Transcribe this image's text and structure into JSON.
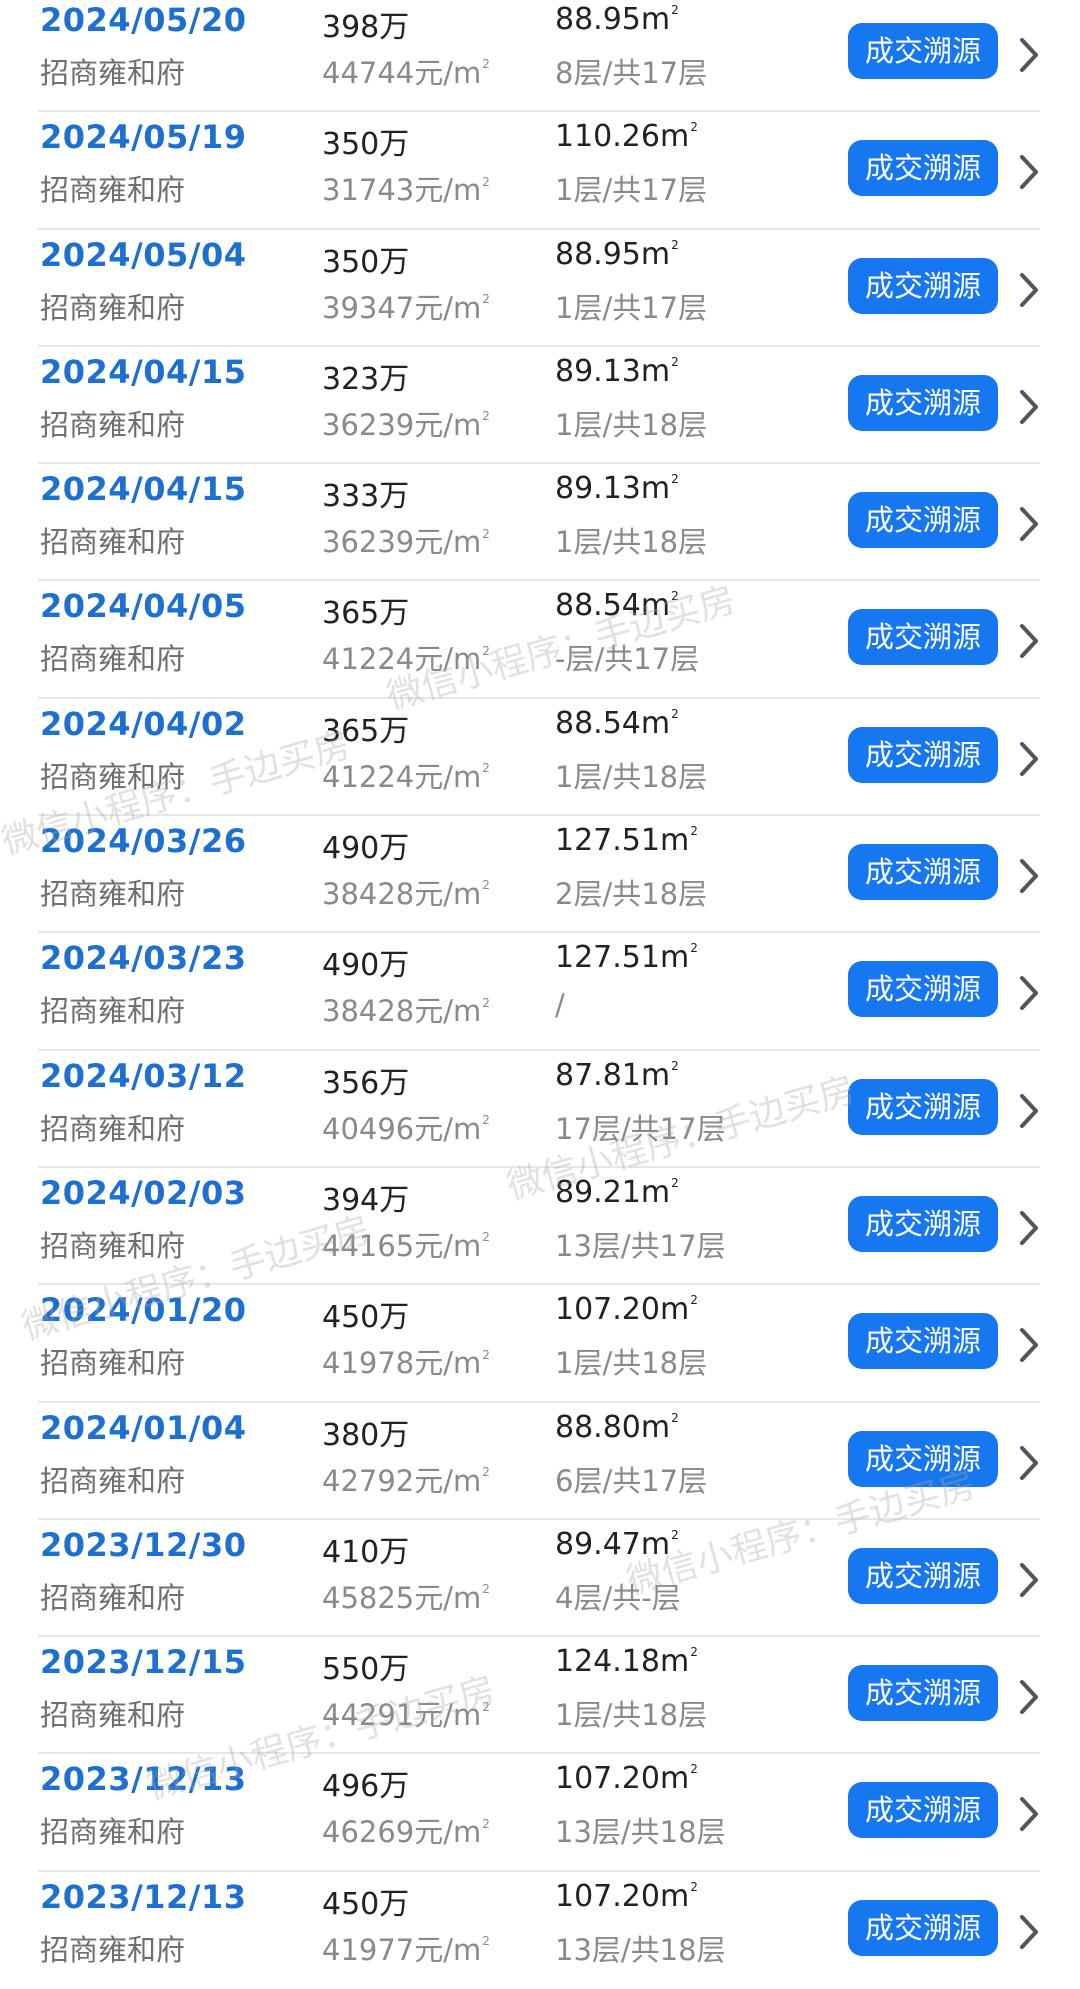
{
  "common": {
    "button_label": "成交溯源",
    "sq_sup": "2"
  },
  "records": [
    {
      "date": "2024/05/20",
      "name": "招商雍和府",
      "price": "398万",
      "unit_price": "44744元/m",
      "area": "88.95m",
      "floor": "8层/共17层"
    },
    {
      "date": "2024/05/19",
      "name": "招商雍和府",
      "price": "350万",
      "unit_price": "31743元/m",
      "area": "110.26m",
      "floor": "1层/共17层"
    },
    {
      "date": "2024/05/04",
      "name": "招商雍和府",
      "price": "350万",
      "unit_price": "39347元/m",
      "area": "88.95m",
      "floor": "1层/共17层"
    },
    {
      "date": "2024/04/15",
      "name": "招商雍和府",
      "price": "323万",
      "unit_price": "36239元/m",
      "area": "89.13m",
      "floor": "1层/共18层"
    },
    {
      "date": "2024/04/15",
      "name": "招商雍和府",
      "price": "333万",
      "unit_price": "36239元/m",
      "area": "89.13m",
      "floor": "1层/共18层"
    },
    {
      "date": "2024/04/05",
      "name": "招商雍和府",
      "price": "365万",
      "unit_price": "41224元/m",
      "area": "88.54m",
      "floor": "-层/共17层"
    },
    {
      "date": "2024/04/02",
      "name": "招商雍和府",
      "price": "365万",
      "unit_price": "41224元/m",
      "area": "88.54m",
      "floor": "1层/共18层"
    },
    {
      "date": "2024/03/26",
      "name": "招商雍和府",
      "price": "490万",
      "unit_price": "38428元/m",
      "area": "127.51m",
      "floor": "2层/共18层"
    },
    {
      "date": "2024/03/23",
      "name": "招商雍和府",
      "price": "490万",
      "unit_price": "38428元/m",
      "area": "127.51m",
      "floor": "/"
    },
    {
      "date": "2024/03/12",
      "name": "招商雍和府",
      "price": "356万",
      "unit_price": "40496元/m",
      "area": "87.81m",
      "floor": "17层/共17层"
    },
    {
      "date": "2024/02/03",
      "name": "招商雍和府",
      "price": "394万",
      "unit_price": "44165元/m",
      "area": "89.21m",
      "floor": "13层/共17层"
    },
    {
      "date": "2024/01/20",
      "name": "招商雍和府",
      "price": "450万",
      "unit_price": "41978元/m",
      "area": "107.20m",
      "floor": "1层/共18层"
    },
    {
      "date": "2024/01/04",
      "name": "招商雍和府",
      "price": "380万",
      "unit_price": "42792元/m",
      "area": "88.80m",
      "floor": "6层/共17层"
    },
    {
      "date": "2023/12/30",
      "name": "招商雍和府",
      "price": "410万",
      "unit_price": "45825元/m",
      "area": "89.47m",
      "floor": "4层/共-层"
    },
    {
      "date": "2023/12/15",
      "name": "招商雍和府",
      "price": "550万",
      "unit_price": "44291元/m",
      "area": "124.18m",
      "floor": "1层/共18层"
    },
    {
      "date": "2023/12/13",
      "name": "招商雍和府",
      "price": "496万",
      "unit_price": "46269元/m",
      "area": "107.20m",
      "floor": "13层/共18层"
    },
    {
      "date": "2023/12/13",
      "name": "招商雍和府",
      "price": "450万",
      "unit_price": "41977元/m",
      "area": "107.20m",
      "floor": "13层/共18层"
    }
  ],
  "watermark": {
    "text": "微信小程序：手边买房"
  }
}
